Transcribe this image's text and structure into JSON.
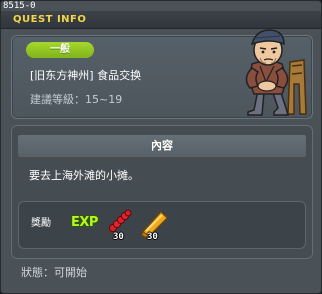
{
  "window": {
    "id_label": "8515-0",
    "title": "QUEST INFO"
  },
  "quest": {
    "difficulty": "一般",
    "name": "[旧东方神州] 食品交换",
    "level": "建議等級：15~19",
    "npc_portrait": "old-man-on-chair"
  },
  "content": {
    "header": "內容",
    "description": "要去上海外滩的小摊。"
  },
  "reward": {
    "label": "獎勵",
    "exp_text": "EXP",
    "items": [
      {
        "icon": "red-skewer-icon",
        "quantity": "30"
      },
      {
        "icon": "golden-stick-icon",
        "quantity": "30"
      }
    ]
  },
  "status": "狀態：可開始",
  "colors": {
    "title": "#f2d64a",
    "badge": "#8fc322",
    "exp": "#b7f523",
    "window": "#4a5258"
  }
}
